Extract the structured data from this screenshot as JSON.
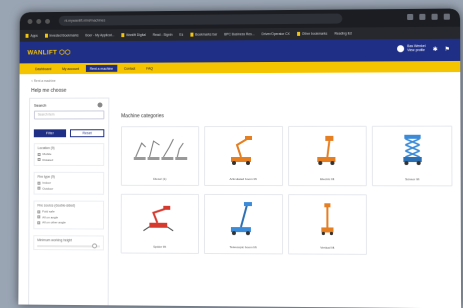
{
  "browser": {
    "address": "nl.mywanlift.nl/nl/machines",
    "bookmarks": [
      "Apps",
      "Invested Bookmarks",
      "Boor - My Applicat...",
      "Wanlift Digital",
      "Read - Signin",
      "Es",
      "Bookmarks bar",
      "BPC Business Res...",
      "Driver/Operator CX",
      "Other bookmarks",
      "Reading list"
    ]
  },
  "header": {
    "logo": "WANLIFT ⬡⬡",
    "account_name": "Bas Wenkel",
    "account_sub": "View profile"
  },
  "nav": [
    "Dashboard",
    "My account",
    "Rent a machine",
    "Contact",
    "FAQ"
  ],
  "breadcrumb": "< Rent a machine",
  "sidebar": {
    "title": "Help me choose",
    "search_label": "Search",
    "search_placeholder": "Search item",
    "filter_btn": "Filter",
    "reset_btn": "Reset",
    "groups": [
      {
        "title": "Location (9)",
        "options": [
          "Mobile",
          "Rotated"
        ]
      },
      {
        "title": "Fire type (9)",
        "options": [
          "Indoor",
          "Outdoor"
        ]
      },
      {
        "title": "Fire source (double-sided)",
        "options": [
          "Fold safe",
          "All on angle",
          "All on other angle"
        ]
      }
    ],
    "range_label": "Minimum working height"
  },
  "categories": {
    "title": "Machine categories",
    "items": [
      {
        "label": "Diesel (1)",
        "icon": "scissor-fleet-icon"
      },
      {
        "label": "Articulated boom lift",
        "icon": "articulated-boom-orange-icon"
      },
      {
        "label": "Electric lift",
        "icon": "boom-lift-orange-icon"
      },
      {
        "label": "Scissor lift",
        "icon": "scissor-lift-blue-icon"
      },
      {
        "label": "Spider lift",
        "icon": "spider-lift-red-icon"
      },
      {
        "label": "Telescopic boom lift",
        "icon": "telescopic-boom-blue-icon"
      },
      {
        "label": "Vertical lift",
        "icon": "vertical-mast-orange-icon"
      }
    ]
  },
  "colors": {
    "brand_blue": "#1f2f86",
    "brand_yellow": "#f5c400"
  }
}
